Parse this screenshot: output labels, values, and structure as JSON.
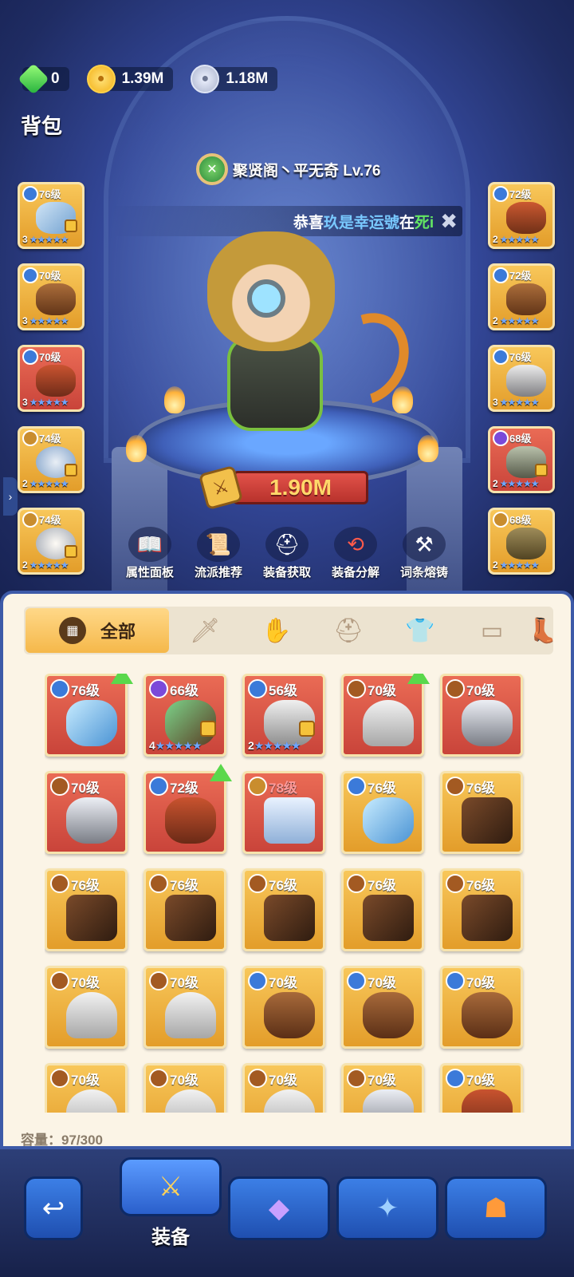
{
  "currency": {
    "gems": "0",
    "gold": "1.39M",
    "silver": "1.18M"
  },
  "page_title": "背包",
  "player": {
    "name": "聚贤阁丶平无奇 Lv.76"
  },
  "ticker": {
    "prefix": "恭喜",
    "name": "玖是幸运號",
    "mid": "在",
    "tail": "死i"
  },
  "power": "1.90M",
  "actions": [
    {
      "label": "属性面板",
      "icon": "book-icon"
    },
    {
      "label": "流派推荐",
      "icon": "scroll-icon"
    },
    {
      "label": "装备获取",
      "icon": "helmet-icon"
    },
    {
      "label": "装备分解",
      "icon": "recycle-icon"
    },
    {
      "label": "词条熔铸",
      "icon": "forge-icon"
    }
  ],
  "left_slots": [
    {
      "level": "76级",
      "star": "3",
      "stars": "★★★★★"
    },
    {
      "level": "70级",
      "star": "3",
      "stars": "★★★★★"
    },
    {
      "level": "70级",
      "star": "3",
      "stars": "★★★★★"
    },
    {
      "level": "74级",
      "star": "2",
      "stars": "★★★★★"
    },
    {
      "level": "74级",
      "star": "2",
      "stars": "★★★★★"
    }
  ],
  "right_slots": [
    {
      "level": "72级",
      "star": "2",
      "stars": "★★★★★"
    },
    {
      "level": "72级",
      "star": "2",
      "stars": "★★★★★"
    },
    {
      "level": "76级",
      "star": "3",
      "stars": "★★★★★"
    },
    {
      "level": "68级",
      "star": "2",
      "stars": "★★★★★"
    },
    {
      "level": "68级",
      "star": "2",
      "stars": "★★★★★"
    }
  ],
  "tabs": {
    "all_label": "全部",
    "icons": [
      "sword-icon",
      "glove-icon",
      "helmet-icon",
      "armor-icon",
      "pants-icon",
      "boots-icon"
    ]
  },
  "items": [
    {
      "level": "76级"
    },
    {
      "level": "66级",
      "star": "4",
      "stars": "★★★★★"
    },
    {
      "level": "56级",
      "star": "2",
      "stars": "★★★★★"
    },
    {
      "level": "70级"
    },
    {
      "level": "70级"
    },
    {
      "level": "70级"
    },
    {
      "level": "72级"
    },
    {
      "level": "78级"
    },
    {
      "level": "76级"
    },
    {
      "level": "76级"
    },
    {
      "level": "76级"
    },
    {
      "level": "76级"
    },
    {
      "level": "76级"
    },
    {
      "level": "76级"
    },
    {
      "level": "76级"
    },
    {
      "level": "70级"
    },
    {
      "level": "70级"
    },
    {
      "level": "70级"
    },
    {
      "level": "70级"
    },
    {
      "level": "70级"
    },
    {
      "level": "70级"
    },
    {
      "level": "70级"
    },
    {
      "level": "70级"
    },
    {
      "level": "70级"
    },
    {
      "level": "70级"
    }
  ],
  "capacity": "容量：97/300",
  "nav": {
    "equip_label": "装备"
  }
}
